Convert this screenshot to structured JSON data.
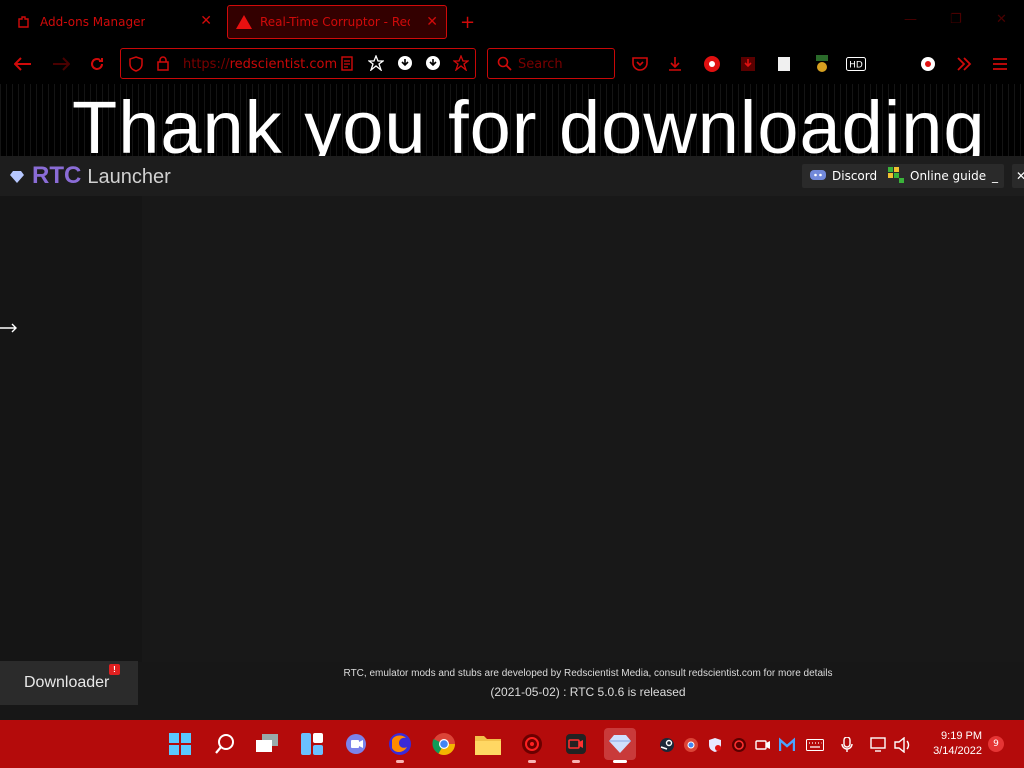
{
  "browser": {
    "tabs": [
      {
        "label": "Add-ons Manager",
        "icon": "puzzle-icon"
      },
      {
        "label": "Real-Time Corruptor - Redsci",
        "icon": "warning-triangle-icon"
      }
    ],
    "url_domain": "redscientist.com",
    "url_prefix": "https://",
    "search_placeholder": "Search"
  },
  "page": {
    "heading": "Thank you for downloading"
  },
  "launcher": {
    "brand_rtc": "RTC",
    "brand_launcher": "Launcher",
    "discord_label": "Discord",
    "guide_label": "Online guide",
    "minimize_label": "_",
    "downloader_label": "Downloader",
    "downloader_badge": "!",
    "footer_note": "RTC, emulator mods and stubs are developed by Redscientist Media, consult redscientist.com for more details",
    "release_note": "(2021-05-02) : RTC 5.0.6 is released"
  },
  "taskbar": {
    "time": "9:19 PM",
    "date": "3/14/2022",
    "notification_count": "9"
  },
  "colors": {
    "accent_red": "#d00a0a",
    "taskbar_red": "#b40b0b",
    "brand_purple": "#8a6cd6"
  }
}
